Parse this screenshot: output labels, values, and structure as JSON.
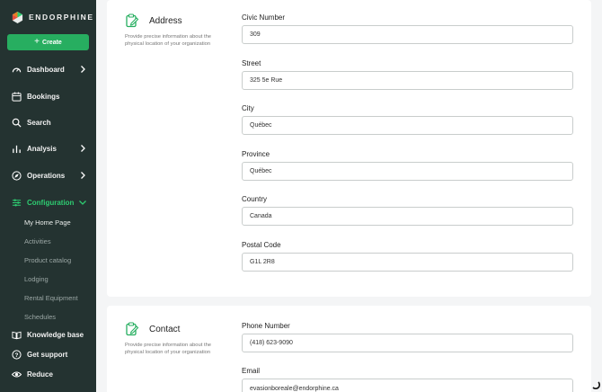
{
  "app": {
    "brand": "ENDORPHINE"
  },
  "sidebar": {
    "create_label": "Create",
    "items": [
      {
        "label": "Dashboard"
      },
      {
        "label": "Bookings"
      },
      {
        "label": "Search"
      },
      {
        "label": "Analysis"
      },
      {
        "label": "Operations"
      },
      {
        "label": "Configuration"
      }
    ],
    "sub_items": [
      {
        "label": "My Home Page"
      },
      {
        "label": "Activities"
      },
      {
        "label": "Product catalog"
      },
      {
        "label": "Lodging"
      },
      {
        "label": "Rental Equipment"
      },
      {
        "label": "Schedules"
      }
    ],
    "bottom": [
      {
        "label": "Knowledge base"
      },
      {
        "label": "Get support"
      },
      {
        "label": "Reduce"
      }
    ]
  },
  "address": {
    "title": "Address",
    "description": "Provide precise information about the physical location of your organization",
    "fields": [
      {
        "label": "Civic Number",
        "value": "309"
      },
      {
        "label": "Street",
        "value": "325 5e Rue"
      },
      {
        "label": "City",
        "value": "Québec"
      },
      {
        "label": "Province",
        "value": "Québec"
      },
      {
        "label": "Country",
        "value": "Canada"
      },
      {
        "label": "Postal Code",
        "value": "G1L 2R8"
      }
    ]
  },
  "contact": {
    "title": "Contact",
    "description": "Provide precise information about the physical location of your organization",
    "fields": [
      {
        "label": "Phone Number",
        "value": "(418) 623-9090"
      },
      {
        "label": "Email",
        "value": "evasionboreale@endorphine.ca"
      }
    ]
  },
  "colors": {
    "sidebar_bg": "#243331",
    "accent": "#27ae60"
  }
}
